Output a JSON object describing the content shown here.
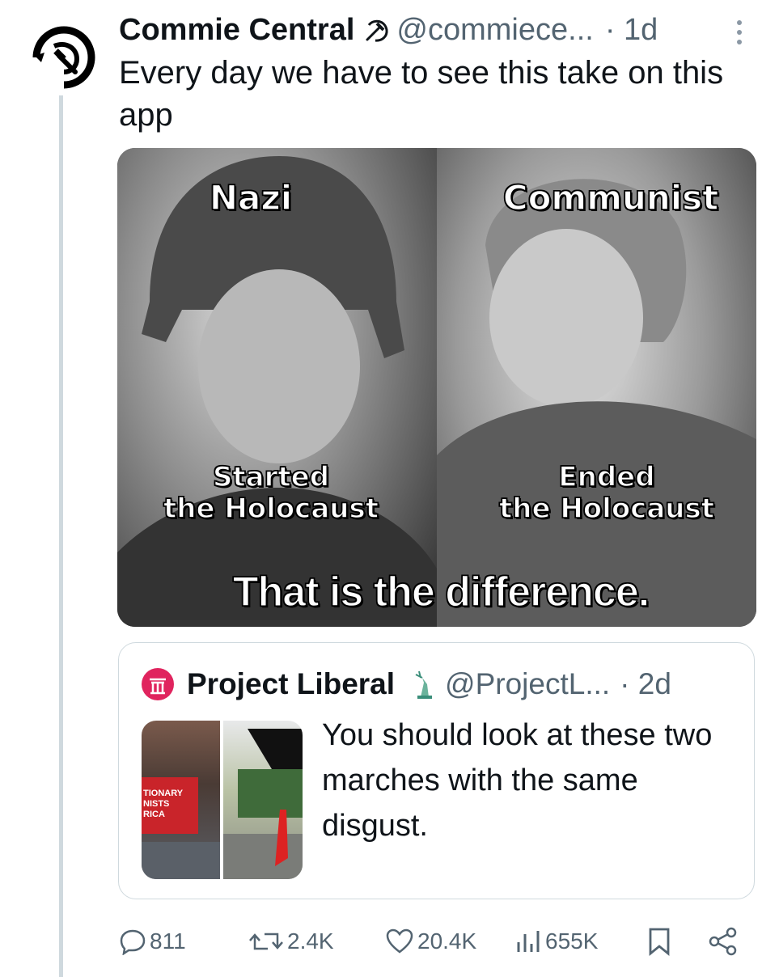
{
  "tweet": {
    "author_name": "Commie Central",
    "handle": "@commiece...",
    "time": "· 1d",
    "text": "Every day we have to see this take on this app",
    "media": {
      "left_label": "Nazi",
      "right_label": "Communist",
      "left_caption_line1": "Started",
      "left_caption_line2": "the Holocaust",
      "right_caption_line1": "Ended",
      "right_caption_line2": "the Holocaust",
      "bottom_caption": "That is the difference."
    }
  },
  "quote": {
    "author_name": "Project Liberal",
    "handle": "@ProjectL...",
    "time": "· 2d",
    "text": "You should look at these two marches with the same disgust.",
    "thumb_banner_text": "TIONARY NISTS RICA"
  },
  "actions": {
    "replies": "811",
    "retweets": "2.4K",
    "likes": "20.4K",
    "views": "655K"
  },
  "icons": {
    "avatar": "hammer-sickle-avatar-icon",
    "verified_badge": "hammer-sickle-icon",
    "quote_avatar": "project-liberal-logo-icon",
    "quote_badge": "statue-of-liberty-icon",
    "more": "more-vertical-icon",
    "reply": "reply-icon",
    "retweet": "retweet-icon",
    "like": "heart-icon",
    "views": "views-icon",
    "bookmark": "bookmark-icon",
    "share": "share-icon"
  },
  "colors": {
    "text": "#0f1419",
    "muted": "#536471",
    "border": "#cfd9de",
    "quote_logo": "#e0245e"
  }
}
